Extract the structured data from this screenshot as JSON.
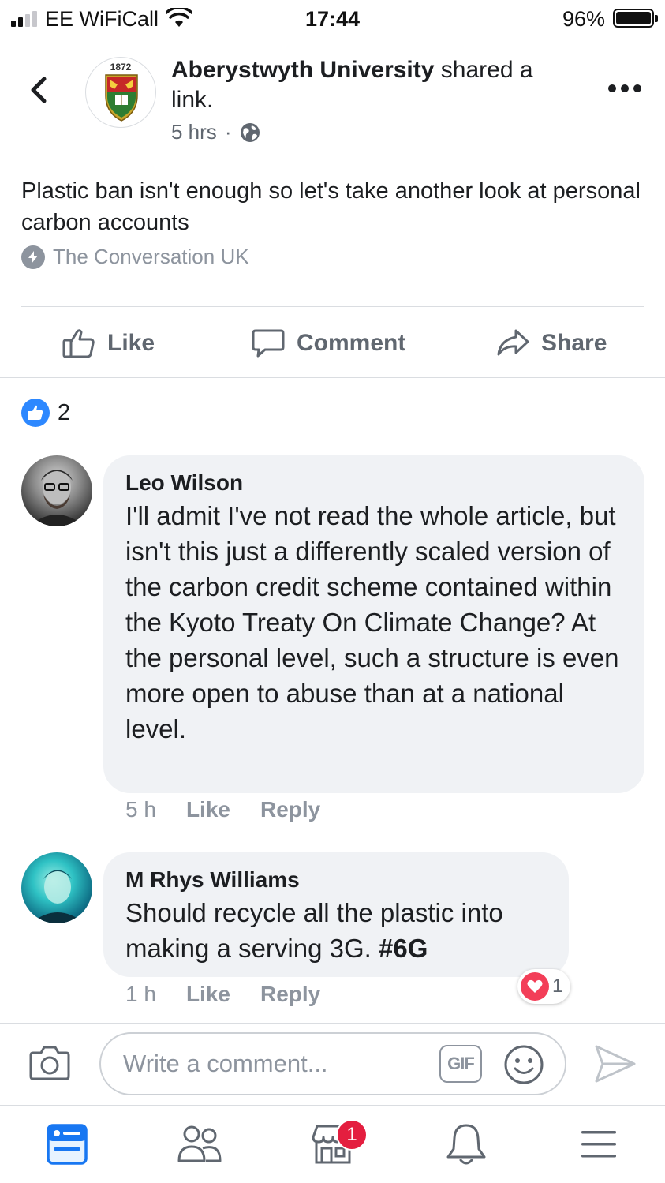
{
  "status_bar": {
    "carrier": "EE WiFiCall",
    "time": "17:44",
    "battery_percent": "96%",
    "signal_bars": 4,
    "signal_bars_filled": 2
  },
  "post": {
    "page_name": "Aberystwyth University",
    "action_text": "shared a link.",
    "time": "5 hrs",
    "separator": "·",
    "privacy_icon": "globe-icon",
    "avatar_year": "1872"
  },
  "link": {
    "title": "Plastic ban isn't enough so let's take another look at personal carbon accounts",
    "source": "The Conversation UK"
  },
  "actions": {
    "like": "Like",
    "comment": "Comment",
    "share": "Share"
  },
  "reactions": {
    "count": "2"
  },
  "comments": [
    {
      "author": "Leo Wilson",
      "text": "I'll admit I've not read the whole article, but isn't this just a differently scaled version of the carbon credit scheme contained within the Kyoto Treaty On Climate Change?  At the personal level, such a structure is even more open to abuse than at a national level.",
      "time": "5 h",
      "like": "Like",
      "reply": "Reply"
    },
    {
      "author": "M Rhys Williams",
      "text": "Should recycle all the plastic into making a serving 3G.",
      "hashtag": "#6G",
      "time": "1 h",
      "like": "Like",
      "reply": "Reply",
      "reaction_count": "1"
    }
  ],
  "composer": {
    "placeholder": "Write a comment...",
    "gif_label": "GIF"
  },
  "tab_bar": {
    "items": [
      "news-feed-icon",
      "friends-icon",
      "marketplace-icon",
      "notifications-icon",
      "menu-icon"
    ],
    "marketplace_badge": "1"
  },
  "colors": {
    "accent": "#2d88ff",
    "bubble": "#f0f2f5",
    "muted": "#8d949e",
    "badge": "#e41e3f",
    "love": "#f33e58"
  }
}
